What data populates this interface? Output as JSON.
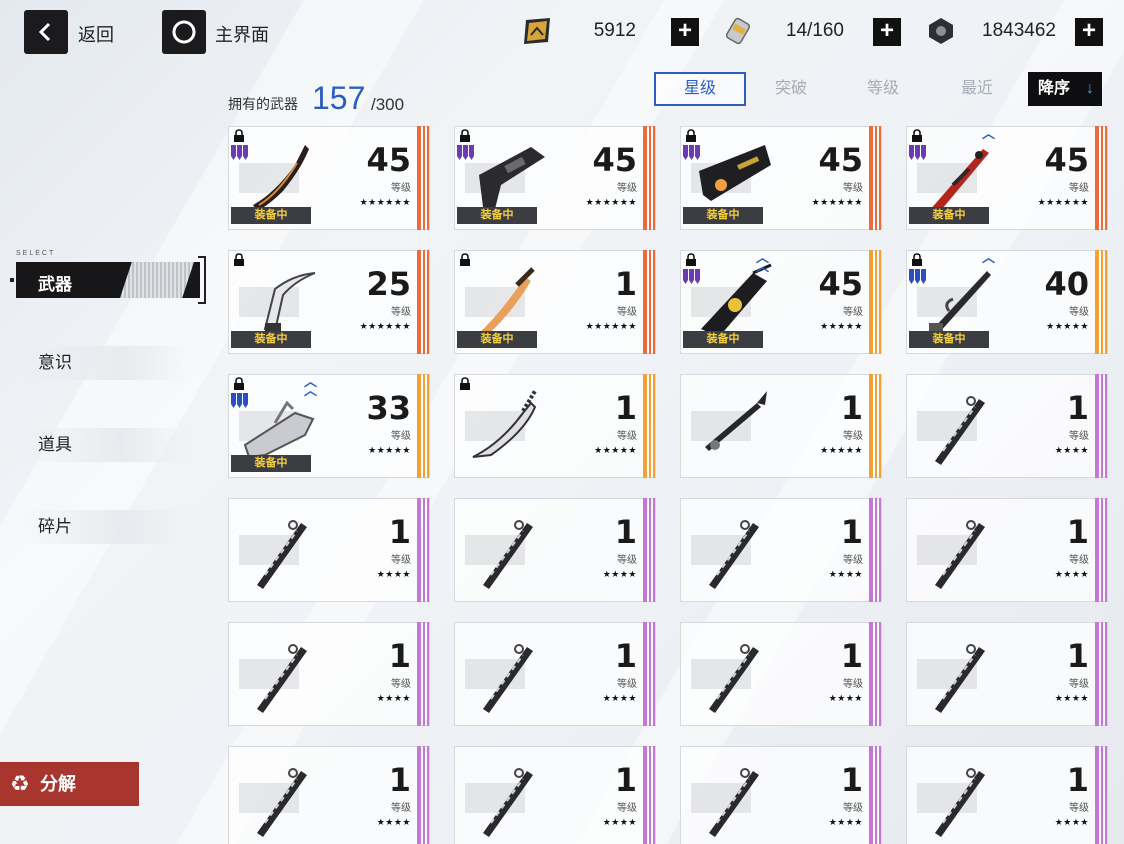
{
  "topbar": {
    "back_label": "返回",
    "home_label": "主界面",
    "resources": [
      {
        "icon": "gold-ticket-icon",
        "value": "5912"
      },
      {
        "icon": "energy-canister-icon",
        "value": "14/160"
      },
      {
        "icon": "nut-icon",
        "value": "1843462"
      }
    ],
    "plus_label": "+"
  },
  "header": {
    "owned_label": "拥有的武器",
    "owned_count": "157",
    "owned_max": "/300"
  },
  "sort": {
    "tabs": [
      "星级",
      "突破",
      "等级",
      "最近"
    ],
    "active": "星级",
    "order_label": "降序",
    "order_arrow": "↓"
  },
  "sidebar": {
    "select_label": "SELECT",
    "items": [
      "武器",
      "意识",
      "道具",
      "碎片"
    ],
    "active": "武器"
  },
  "decompose_label": "分解",
  "card_text": {
    "level_label": "等级",
    "equipped_label": "装备中"
  },
  "colors": {
    "orange": "#ef6a3a",
    "gold": "#f1a233",
    "purple": "#c477d4",
    "accent": "#2b5fbf",
    "decompose": "#a8362f"
  },
  "weapons": [
    {
      "level": "45",
      "stars": "★★★★★★",
      "rarity": "orange",
      "locked": true,
      "equipped": true,
      "ranks": "purple",
      "chevrons": 0,
      "icon": "dark-blade-icon"
    },
    {
      "level": "45",
      "stars": "★★★★★★",
      "rarity": "orange",
      "locked": true,
      "equipped": true,
      "ranks": "purple",
      "chevrons": 0,
      "icon": "black-gun-icon"
    },
    {
      "level": "45",
      "stars": "★★★★★★",
      "rarity": "orange",
      "locked": true,
      "equipped": true,
      "ranks": "purple",
      "chevrons": 0,
      "icon": "black-cannon-icon"
    },
    {
      "level": "45",
      "stars": "★★★★★★",
      "rarity": "orange",
      "locked": true,
      "equipped": true,
      "ranks": "purple",
      "chevrons": 1,
      "icon": "red-sword-icon"
    },
    {
      "level": "25",
      "stars": "★★★★★★",
      "rarity": "orange",
      "locked": true,
      "equipped": true,
      "ranks": "none",
      "chevrons": 0,
      "icon": "white-scythe-icon"
    },
    {
      "level": "1",
      "stars": "★★★★★★",
      "rarity": "orange",
      "locked": true,
      "equipped": true,
      "ranks": "none",
      "chevrons": 0,
      "icon": "flame-sword-icon"
    },
    {
      "level": "45",
      "stars": "★★★★★",
      "rarity": "gold",
      "locked": true,
      "equipped": true,
      "ranks": "purple",
      "chevrons": 2,
      "icon": "black-chainsaw-icon"
    },
    {
      "level": "40",
      "stars": "★★★★★",
      "rarity": "gold",
      "locked": true,
      "equipped": true,
      "ranks": "blue",
      "chevrons": 1,
      "icon": "black-spear-icon"
    },
    {
      "level": "33",
      "stars": "★★★★★",
      "rarity": "gold",
      "locked": true,
      "equipped": true,
      "ranks": "blue-small",
      "chevrons": 2,
      "icon": "silver-gun-icon"
    },
    {
      "level": "1",
      "stars": "★★★★★",
      "rarity": "gold",
      "locked": true,
      "equipped": false,
      "ranks": "none",
      "chevrons": 0,
      "icon": "silver-blade-icon"
    },
    {
      "level": "1",
      "stars": "★★★★★",
      "rarity": "gold",
      "locked": false,
      "equipped": false,
      "ranks": "none",
      "chevrons": 0,
      "icon": "black-lance-icon"
    },
    {
      "level": "1",
      "stars": "★★★★",
      "rarity": "purple",
      "locked": false,
      "equipped": false,
      "ranks": "none",
      "chevrons": 0,
      "icon": "black-katana-icon"
    },
    {
      "level": "1",
      "stars": "★★★★",
      "rarity": "purple",
      "locked": false,
      "equipped": false,
      "ranks": "none",
      "chevrons": 0,
      "icon": "black-katana-icon"
    },
    {
      "level": "1",
      "stars": "★★★★",
      "rarity": "purple",
      "locked": false,
      "equipped": false,
      "ranks": "none",
      "chevrons": 0,
      "icon": "black-katana-icon"
    },
    {
      "level": "1",
      "stars": "★★★★",
      "rarity": "purple",
      "locked": false,
      "equipped": false,
      "ranks": "none",
      "chevrons": 0,
      "icon": "black-katana-icon"
    },
    {
      "level": "1",
      "stars": "★★★★",
      "rarity": "purple",
      "locked": false,
      "equipped": false,
      "ranks": "none",
      "chevrons": 0,
      "icon": "black-katana-icon"
    },
    {
      "level": "1",
      "stars": "★★★★",
      "rarity": "purple",
      "locked": false,
      "equipped": false,
      "ranks": "none",
      "chevrons": 0,
      "icon": "black-katana-icon"
    },
    {
      "level": "1",
      "stars": "★★★★",
      "rarity": "purple",
      "locked": false,
      "equipped": false,
      "ranks": "none",
      "chevrons": 0,
      "icon": "black-katana-icon"
    },
    {
      "level": "1",
      "stars": "★★★★",
      "rarity": "purple",
      "locked": false,
      "equipped": false,
      "ranks": "none",
      "chevrons": 0,
      "icon": "black-katana-icon"
    },
    {
      "level": "1",
      "stars": "★★★★",
      "rarity": "purple",
      "locked": false,
      "equipped": false,
      "ranks": "none",
      "chevrons": 0,
      "icon": "black-katana-icon"
    },
    {
      "level": "1",
      "stars": "★★★★",
      "rarity": "purple",
      "locked": false,
      "equipped": false,
      "ranks": "none",
      "chevrons": 0,
      "icon": "black-katana-icon"
    },
    {
      "level": "1",
      "stars": "★★★★",
      "rarity": "purple",
      "locked": false,
      "equipped": false,
      "ranks": "none",
      "chevrons": 0,
      "icon": "black-katana-icon"
    },
    {
      "level": "1",
      "stars": "★★★★",
      "rarity": "purple",
      "locked": false,
      "equipped": false,
      "ranks": "none",
      "chevrons": 0,
      "icon": "black-katana-icon"
    },
    {
      "level": "1",
      "stars": "★★★★",
      "rarity": "purple",
      "locked": false,
      "equipped": false,
      "ranks": "none",
      "chevrons": 0,
      "icon": "black-katana-icon"
    }
  ]
}
